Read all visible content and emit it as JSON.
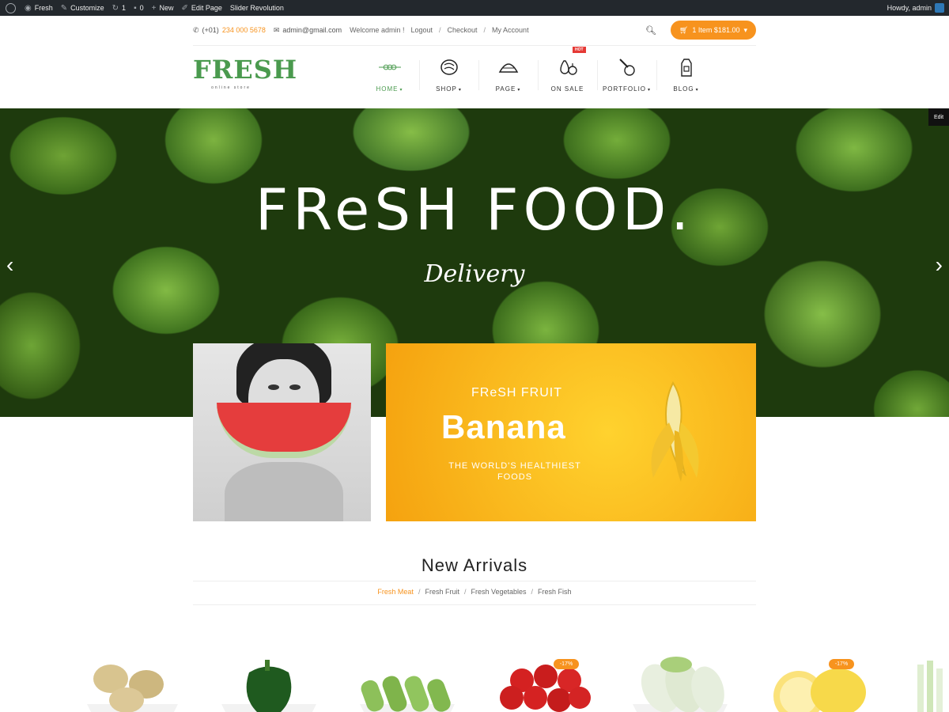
{
  "adminbar": {
    "site": "Fresh",
    "customize": "Customize",
    "updates": "1",
    "comments": "0",
    "new": "New",
    "edit_page": "Edit Page",
    "slider": "Slider Revolution",
    "howdy": "Howdy, admin"
  },
  "topbar": {
    "phone_prefix": "(+01)",
    "phone_number": "234 000 5678",
    "email": "admin@gmail.com",
    "welcome": "Welcome admin !",
    "logout": "Logout",
    "checkout": "Checkout",
    "account": "My Account",
    "separator": "/",
    "cart": "1 Item $181.00"
  },
  "logo": {
    "main": "FRESH",
    "sub": "online store"
  },
  "nav": {
    "items": [
      {
        "label": "HOME",
        "icon": "skewer-icon"
      },
      {
        "label": "SHOP",
        "icon": "meat-icon"
      },
      {
        "label": "PAGE",
        "icon": "taco-icon"
      },
      {
        "label": "ON SALE",
        "icon": "pear-icon",
        "badge": "HOT"
      },
      {
        "label": "PORTFOLIO",
        "icon": "whisk-icon"
      },
      {
        "label": "BLOG",
        "icon": "milk-carton-icon"
      }
    ],
    "caret": "▾"
  },
  "slider": {
    "title": "FReSH FOOD.",
    "subtitle": "Delivery",
    "edit": "Edit",
    "prev": "‹",
    "next": "›"
  },
  "banner": {
    "eyebrow": "FReSH FRUIT",
    "title": "Banana",
    "tagline": "THE WORLD'S HEALTHIEST FOODS"
  },
  "arrivals": {
    "title": "New Arrivals",
    "tabs": [
      "Fresh Meat",
      "Fresh Fruit",
      "Fresh Vegetables",
      "Fresh Fish"
    ],
    "separator": "/",
    "sale_badges": [
      "-17%",
      "-17%"
    ]
  },
  "colors": {
    "accent": "#f7931e",
    "brand_green": "#4a9a4e",
    "admin_bar": "#23282d",
    "hot": "#e53935"
  }
}
